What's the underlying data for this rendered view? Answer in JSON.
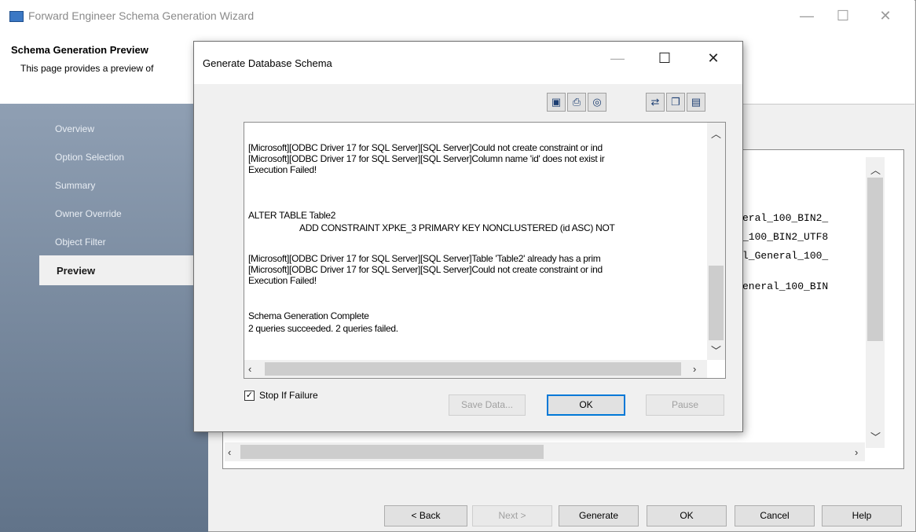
{
  "wizard": {
    "title": "Forward Engineer Schema Generation Wizard",
    "header_title": "Schema Generation Preview",
    "header_subtitle": "This page provides a preview of",
    "minimize": "—",
    "maximize": "☐",
    "close": "✕",
    "sidebar": [
      {
        "label": "Overview"
      },
      {
        "label": "Option Selection"
      },
      {
        "label": "Summary"
      },
      {
        "label": "Owner Override"
      },
      {
        "label": "Object Filter"
      },
      {
        "label": "Preview"
      }
    ],
    "code_fragments": [
      "eral_100_BIN2_",
      "_100_BIN2_UTF8",
      "l_General_100_",
      "eneral_100_BIN"
    ],
    "buttons": {
      "back": "< Back",
      "next": "Next >",
      "generate": "Generate",
      "ok": "OK",
      "cancel": "Cancel",
      "help": "Help"
    }
  },
  "dialog": {
    "title": "Generate Database Schema",
    "minimize": "—",
    "maximize": "☐",
    "close": "✕",
    "toolbar_icons": [
      "save-icon",
      "print-icon",
      "find-icon",
      "connect-icon",
      "copy-icon",
      "paste-icon"
    ],
    "log_lines": [
      "[Microsoft][ODBC Driver 17 for SQL Server][SQL Server]Could not create constraint or ind",
      "[Microsoft][ODBC Driver 17 for SQL Server][SQL Server]Column name 'id' does not exist ir",
      "Execution Failed!",
      "ALTER TABLE Table2",
      "ADD CONSTRAINT XPKE_3 PRIMARY KEY NONCLUSTERED (id ASC) NOT",
      "[Microsoft][ODBC Driver 17 for SQL Server][SQL Server]Table 'Table2' already has a prim",
      "[Microsoft][ODBC Driver 17 for SQL Server][SQL Server]Could not create constraint or ind",
      "Execution Failed!",
      "Schema Generation Complete",
      "2 queries succeeded.  2 queries failed."
    ],
    "stop_if_failure": {
      "label": "Stop If Failure",
      "checked": true
    },
    "buttons": {
      "save_data": "Save Data...",
      "ok": "OK",
      "pause": "Pause"
    }
  }
}
